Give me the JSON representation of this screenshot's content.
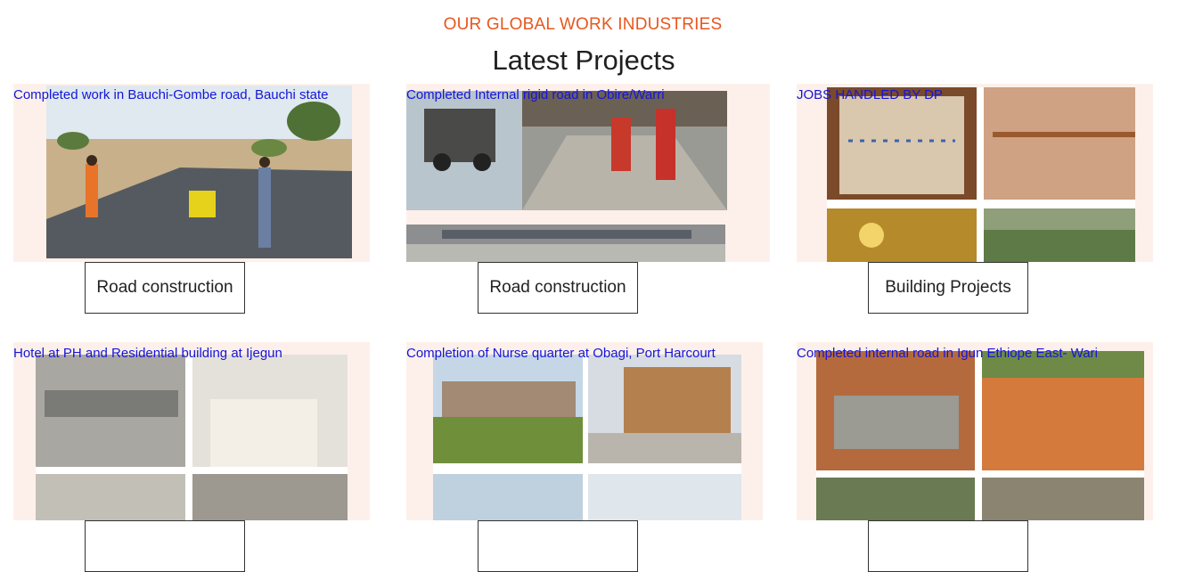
{
  "section": {
    "tagline": "OUR GLOBAL WORK INDUSTRIES",
    "title": "Latest Projects"
  },
  "projects": [
    {
      "caption": "Completed work in Bauchi-Gombe road, Bauchi state",
      "button": "Road construction"
    },
    {
      "caption": "Completed Internal rigid road in Obire/Warri",
      "button": "Road construction"
    },
    {
      "caption": "JOBS HANDLED BY DP",
      "button": "Building Projects"
    },
    {
      "caption": "Hotel at PH and Residential building at Ijegun",
      "button": ""
    },
    {
      "caption": "Completion of Nurse quarter at Obagi, Port Harcourt",
      "button": ""
    },
    {
      "caption": "Completed internal road in Igun Ethiope East- Wari",
      "button": ""
    }
  ],
  "colors": {
    "accent": "#e8571e",
    "caption_link": "#1515d8",
    "card_bg": "#fdf0ea"
  }
}
